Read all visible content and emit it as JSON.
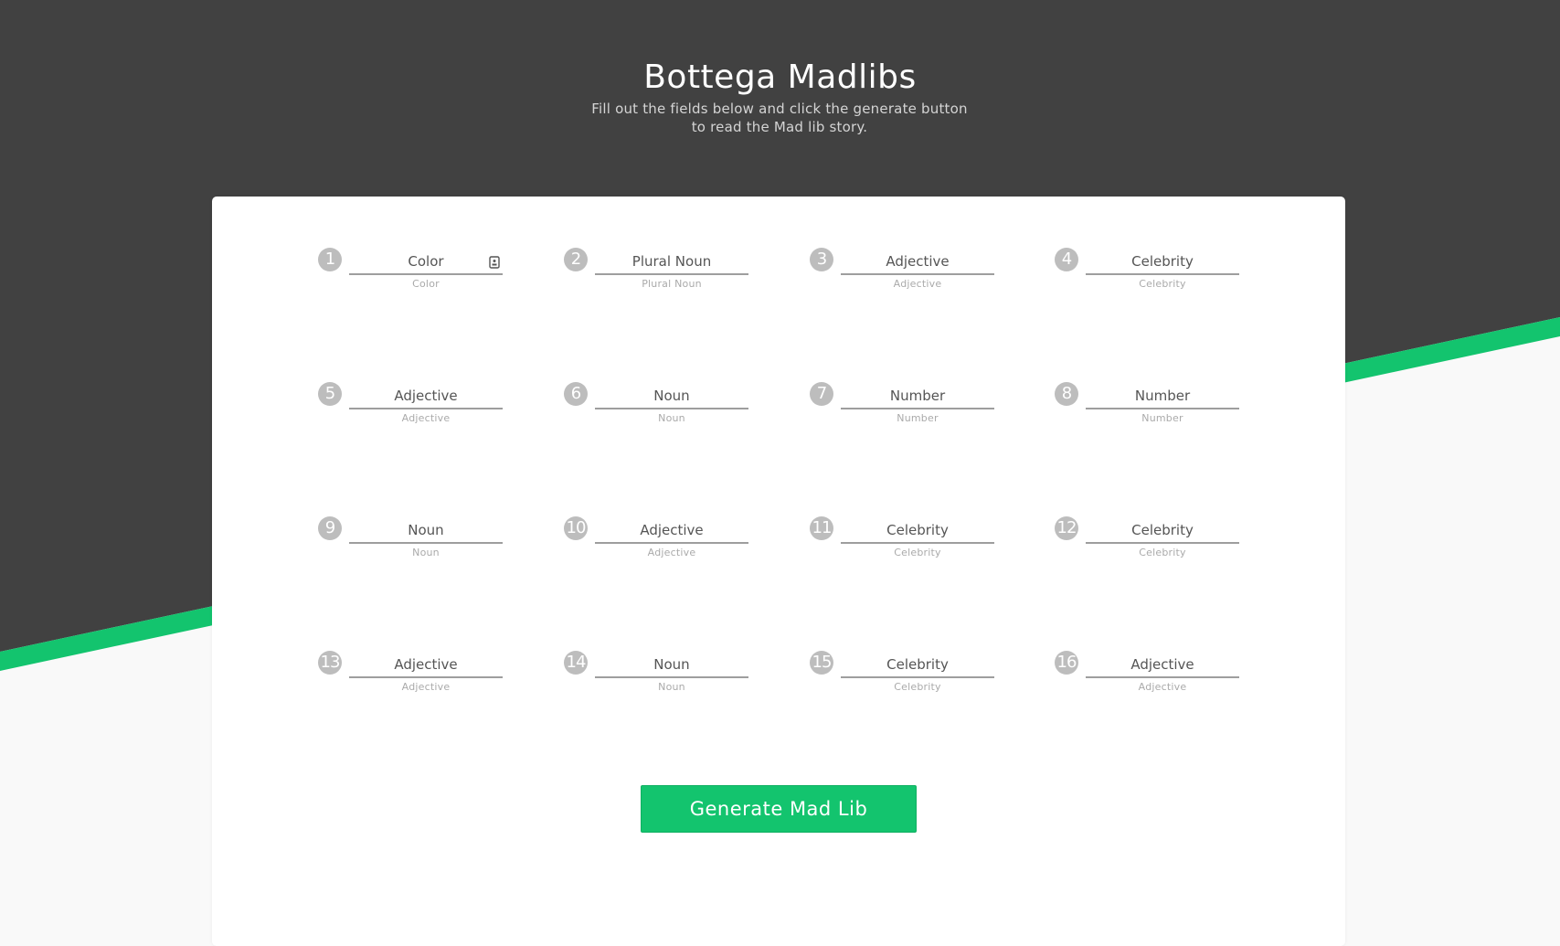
{
  "header": {
    "title": "Bottega Madlibs",
    "subtitle_line1": "Fill out the fields below and click the generate button",
    "subtitle_line2": "to read the Mad lib story."
  },
  "colors": {
    "header_bg": "#414141",
    "accent": "#13c46e",
    "page_bg": "#f9f9f9",
    "badge": "#bdbdbd"
  },
  "fields": [
    {
      "number": "1",
      "placeholder": "Color",
      "helper": "Color",
      "icon": "contact-card-icon"
    },
    {
      "number": "2",
      "placeholder": "Plural Noun",
      "helper": "Plural Noun"
    },
    {
      "number": "3",
      "placeholder": "Adjective",
      "helper": "Adjective"
    },
    {
      "number": "4",
      "placeholder": "Celebrity",
      "helper": "Celebrity"
    },
    {
      "number": "5",
      "placeholder": "Adjective",
      "helper": "Adjective"
    },
    {
      "number": "6",
      "placeholder": "Noun",
      "helper": "Noun"
    },
    {
      "number": "7",
      "placeholder": "Number",
      "helper": "Number"
    },
    {
      "number": "8",
      "placeholder": "Number",
      "helper": "Number"
    },
    {
      "number": "9",
      "placeholder": "Noun",
      "helper": "Noun"
    },
    {
      "number": "10",
      "placeholder": "Adjective",
      "helper": "Adjective"
    },
    {
      "number": "11",
      "placeholder": "Celebrity",
      "helper": "Celebrity"
    },
    {
      "number": "12",
      "placeholder": "Celebrity",
      "helper": "Celebrity"
    },
    {
      "number": "13",
      "placeholder": "Adjective",
      "helper": "Adjective"
    },
    {
      "number": "14",
      "placeholder": "Noun",
      "helper": "Noun"
    },
    {
      "number": "15",
      "placeholder": "Celebrity",
      "helper": "Celebrity"
    },
    {
      "number": "16",
      "placeholder": "Adjective",
      "helper": "Adjective"
    }
  ],
  "generate_button": {
    "label": "Generate Mad Lib"
  }
}
